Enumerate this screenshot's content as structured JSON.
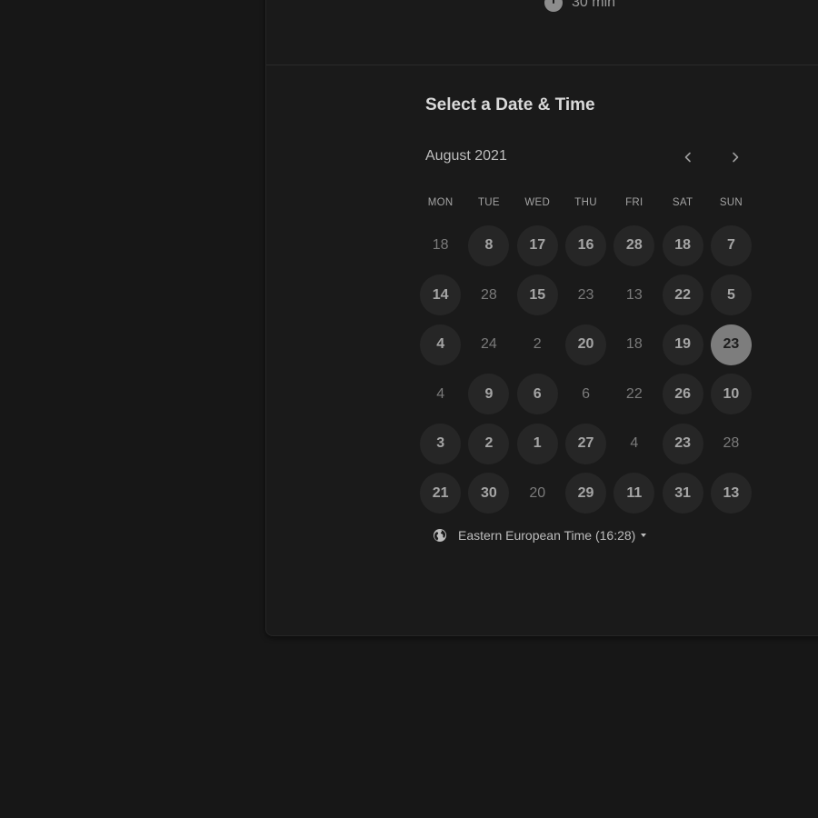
{
  "event": {
    "duration": "30 min"
  },
  "calendar": {
    "title": "Select a Date & Time",
    "month_label": "August 2021",
    "weekdays": [
      "MON",
      "TUE",
      "WED",
      "THU",
      "FRI",
      "SAT",
      "SUN"
    ],
    "rows": [
      [
        {
          "label": "18",
          "state": "unavailable"
        },
        {
          "label": "8",
          "state": "available"
        },
        {
          "label": "17",
          "state": "available"
        },
        {
          "label": "16",
          "state": "available"
        },
        {
          "label": "28",
          "state": "available"
        },
        {
          "label": "18",
          "state": "available"
        },
        {
          "label": "7",
          "state": "available"
        }
      ],
      [
        {
          "label": "14",
          "state": "available"
        },
        {
          "label": "28",
          "state": "unavailable"
        },
        {
          "label": "15",
          "state": "available"
        },
        {
          "label": "23",
          "state": "unavailable"
        },
        {
          "label": "13",
          "state": "unavailable"
        },
        {
          "label": "22",
          "state": "available"
        },
        {
          "label": "5",
          "state": "available"
        }
      ],
      [
        {
          "label": "4",
          "state": "available"
        },
        {
          "label": "24",
          "state": "unavailable"
        },
        {
          "label": "2",
          "state": "unavailable"
        },
        {
          "label": "20",
          "state": "available"
        },
        {
          "label": "18",
          "state": "unavailable"
        },
        {
          "label": "19",
          "state": "available"
        },
        {
          "label": "23",
          "state": "selected"
        }
      ],
      [
        {
          "label": "4",
          "state": "unavailable"
        },
        {
          "label": "9",
          "state": "available"
        },
        {
          "label": "6",
          "state": "available"
        },
        {
          "label": "6",
          "state": "unavailable"
        },
        {
          "label": "22",
          "state": "unavailable"
        },
        {
          "label": "26",
          "state": "available"
        },
        {
          "label": "10",
          "state": "available"
        }
      ],
      [
        {
          "label": "3",
          "state": "available"
        },
        {
          "label": "2",
          "state": "available"
        },
        {
          "label": "1",
          "state": "available"
        },
        {
          "label": "27",
          "state": "available"
        },
        {
          "label": "4",
          "state": "unavailable"
        },
        {
          "label": "23",
          "state": "available"
        },
        {
          "label": "28",
          "state": "unavailable"
        }
      ],
      [
        {
          "label": "21",
          "state": "available"
        },
        {
          "label": "30",
          "state": "available"
        },
        {
          "label": "20",
          "state": "unavailable"
        },
        {
          "label": "29",
          "state": "available"
        },
        {
          "label": "11",
          "state": "available"
        },
        {
          "label": "31",
          "state": "available"
        },
        {
          "label": "13",
          "state": "available"
        }
      ]
    ]
  },
  "timezone": {
    "label": "Eastern European Time (16:28)",
    "icon": "globe-icon"
  },
  "icons": {
    "prev": "chevron-left-icon",
    "next": "chevron-right-icon",
    "duration": "clock-icon"
  },
  "colors": {
    "background": "#171717",
    "card": "#1a1a1a",
    "available_day": "#262626",
    "selected_day": "#7d7d7d"
  }
}
